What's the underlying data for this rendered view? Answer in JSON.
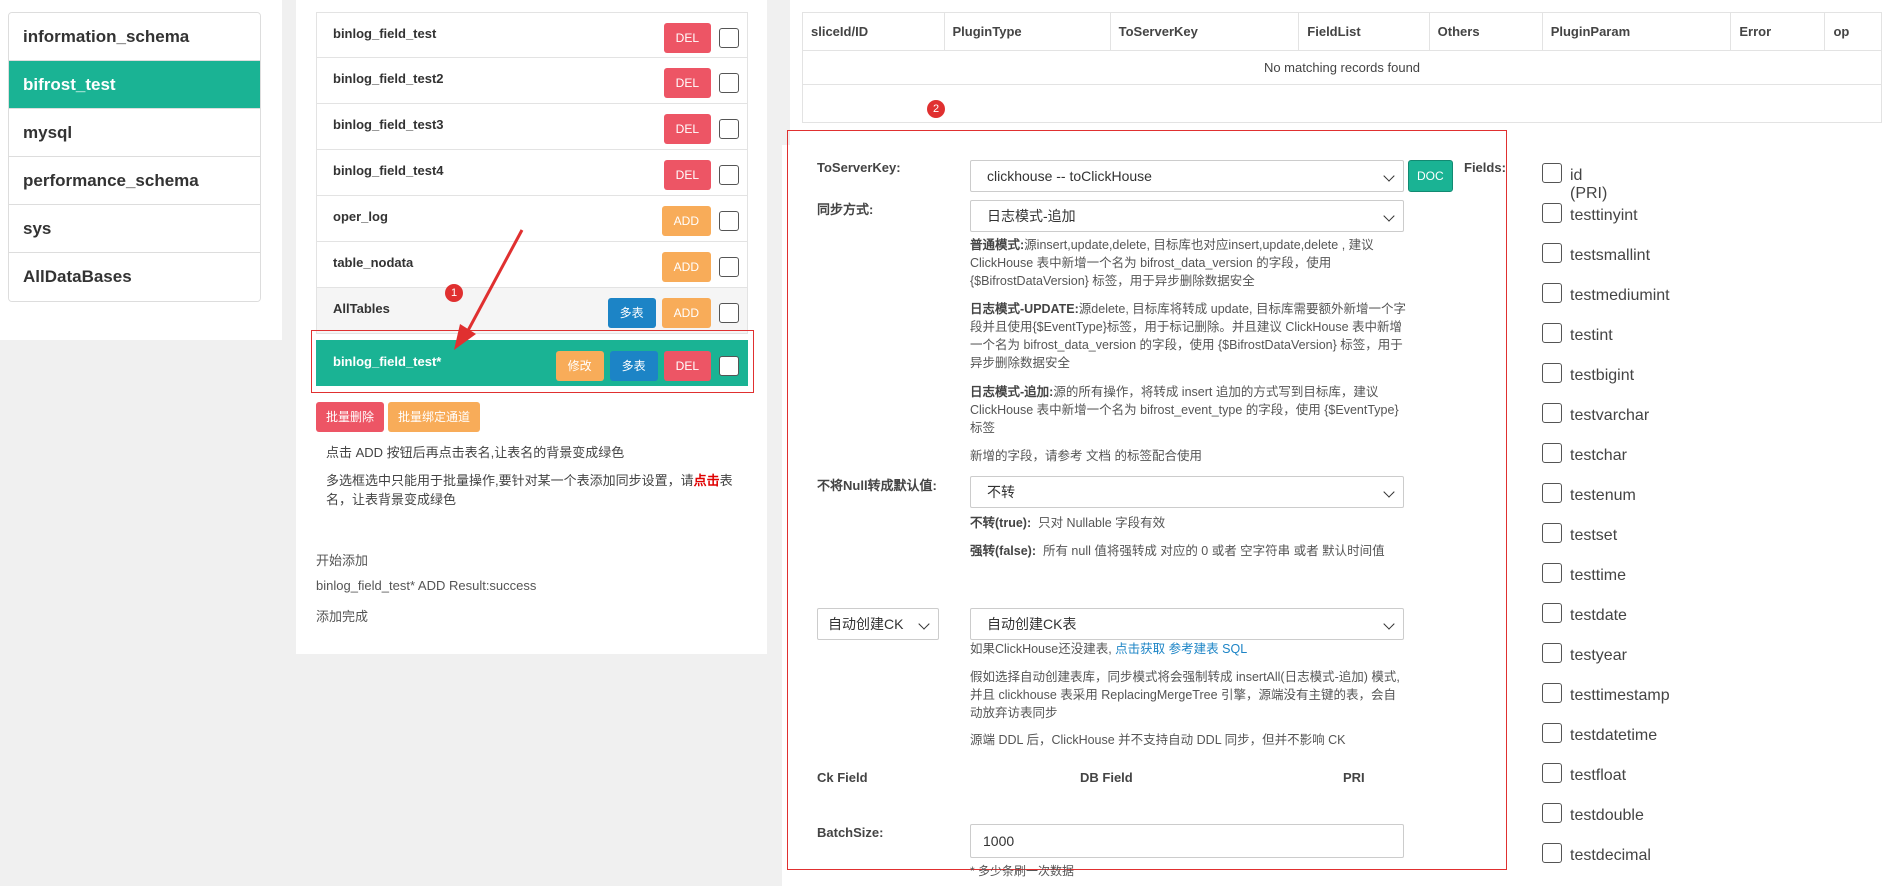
{
  "databases": [
    {
      "name": "information_schema",
      "active": false
    },
    {
      "name": "bifrost_test",
      "active": true
    },
    {
      "name": "mysql",
      "active": false
    },
    {
      "name": "performance_schema",
      "active": false
    },
    {
      "name": "sys",
      "active": false
    },
    {
      "name": "AllDataBases",
      "active": false
    }
  ],
  "tables": {
    "rows": [
      {
        "name": "binlog_field_test",
        "buttons": [
          "DEL"
        ]
      },
      {
        "name": "binlog_field_test2",
        "buttons": [
          "DEL"
        ]
      },
      {
        "name": "binlog_field_test3",
        "buttons": [
          "DEL"
        ]
      },
      {
        "name": "binlog_field_test4",
        "buttons": [
          "DEL"
        ]
      },
      {
        "name": "oper_log",
        "buttons": [
          "ADD"
        ]
      },
      {
        "name": "table_nodata",
        "buttons": [
          "ADD"
        ]
      },
      {
        "name": "AllTables",
        "buttons": [
          "多表",
          "ADD"
        ]
      }
    ],
    "active_row": {
      "name": "binlog_field_test*",
      "buttons": [
        "修改",
        "多表",
        "DEL"
      ]
    }
  },
  "labels": {
    "del": "DEL",
    "add": "ADD",
    "multi": "多表",
    "edit": "修改",
    "bulk_delete": "批量删除",
    "bulk_bind": "批量绑定通道",
    "marker1": "1",
    "marker2": "2",
    "doc": "DOC"
  },
  "hints": {
    "hint1": "点击 ADD 按钮后再点击表名,让表名的背景变成绿色",
    "hint2_a": "多选框选中只能用于批量操作,要针对某一个表添加同步设置，请",
    "hint2_red": "点击",
    "hint2_b": "表名，让表背景变成绿色"
  },
  "log": [
    "开始添加",
    "binlog_field_test* ADD Result:success",
    "添加完成"
  ],
  "grid": {
    "headers": [
      "sliceId/ID",
      "PluginType",
      "ToServerKey",
      "FieldList",
      "Others",
      "PluginParam",
      "Error",
      "op"
    ],
    "empty_text": "No matching records found"
  },
  "form": {
    "to_server_key_label": "ToServerKey:",
    "to_server_key_value": "clickhouse -- toClickHouse",
    "sync_mode_label": "同步方式:",
    "sync_mode_value": "日志模式-追加",
    "mode_normal_title": "普通模式:",
    "mode_normal_desc": "源insert,update,delete, 目标库也对应insert,update,delete , 建议ClickHouse 表中新增一个名为 bifrost_data_version 的字段，使用 {$BifrostDataVersion} 标签，用于异步删除数据安全",
    "mode_update_title": "日志模式-UPDATE:",
    "mode_update_desc": "源delete, 目标库将转成 update, 目标库需要额外新增一个字段并且使用{$EventType}标签，用于标记删除。并且建议 ClickHouse 表中新增一个名为 bifrost_data_version 的字段，使用 {$BifrostDataVersion} 标签，用于异步删除数据安全",
    "mode_append_title": "日志模式-追加:",
    "mode_append_desc": "源的所有操作，将转成 insert 追加的方式写到目标库，建议 ClickHouse 表中新增一个名为 bifrost_event_type 的字段，使用 {$EventType} 标签",
    "mode_note": "新增的字段，请参考 文档 的标签配合使用",
    "null_label": "不将Null转成默认值:",
    "null_value": "不转",
    "null_true_title": "不转(true):",
    "null_true_desc": "只对 Nullable 字段有效",
    "null_false_title": "强转(false):",
    "null_false_desc": "所有 null 值将强转成 对应的 0 或者 空字符串 或者 默认时间值",
    "auto_ck_small": "自动创建CK",
    "auto_ck_value": "自动创建CK表",
    "auto_ck_hint": "如果ClickHouse还没建表,",
    "auto_ck_link1": "点击获取",
    "auto_ck_link2": "参考建表 SQL",
    "auto_ck_desc": "假如选择自动创建表库，同步模式将会强制转成 insertAll(日志模式-追加) 模式,并且 clickhouse 表采用 ReplacingMergeTree 引擎，源端没有主键的表，会自动放弃访表同步",
    "ddl_note": "源端 DDL 后，ClickHouse 并不支持自动 DDL 同步，但并不影响 CK",
    "col_ck_field": "Ck Field",
    "col_db_field": "DB Field",
    "col_pri": "PRI",
    "batch_label": "BatchSize:",
    "batch_value": "1000",
    "batch_note": "* 多少条刷一次数据",
    "fields_label": "Fields:"
  },
  "fields": [
    "id (PRI)",
    "testtinyint",
    "testsmallint",
    "testmediumint",
    "testint",
    "testbigint",
    "testvarchar",
    "testchar",
    "testenum",
    "testset",
    "testtime",
    "testdate",
    "testyear",
    "testtimestamp",
    "testdatetime",
    "testfloat",
    "testdouble",
    "testdecimal"
  ],
  "colors": {
    "active_green": "#1ab394",
    "del_red": "#ed5565",
    "add_orange": "#f8ac59",
    "multi_blue": "#1c84c6",
    "annotation_red": "#e03030"
  }
}
